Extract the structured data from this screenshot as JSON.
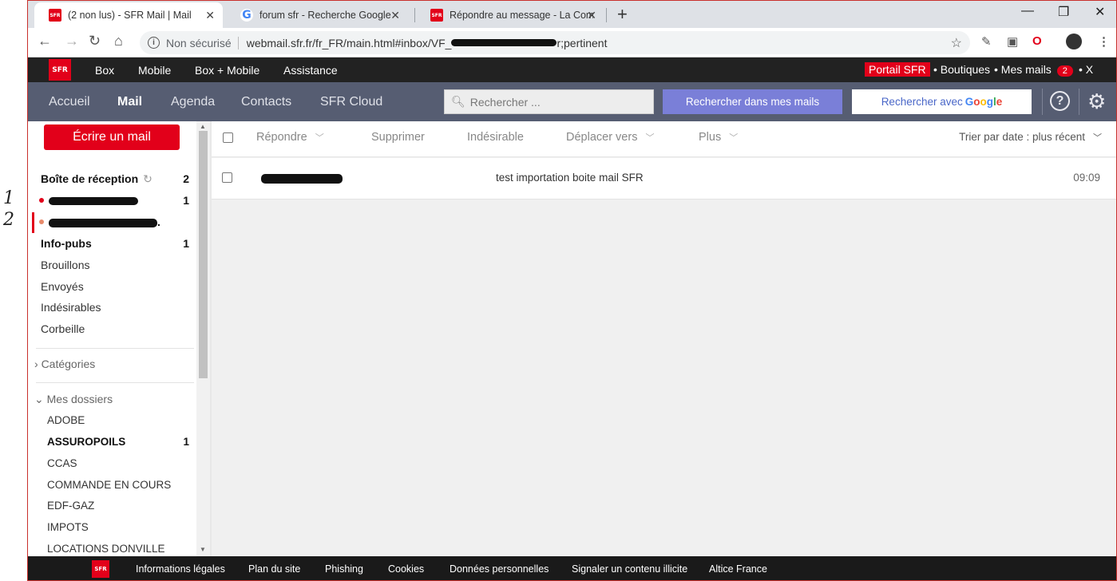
{
  "annotations": {
    "mark1": "1",
    "mark2": "2"
  },
  "browser": {
    "tabs": [
      {
        "title": "(2 non lus) - SFR Mail | Mail",
        "favicon": "sfr-logo",
        "active": true
      },
      {
        "title": "forum sfr - Recherche Google",
        "favicon": "google-logo",
        "active": false
      },
      {
        "title": "Répondre au message - La Comm",
        "favicon": "sfr-logo",
        "active": false
      }
    ],
    "favicon_text": "SFR",
    "address": {
      "security": "Non sécurisé",
      "url_start": "webmail.sfr.fr/fr_FR/main.html#inbox/VF_",
      "url_end": "r;pertinent"
    }
  },
  "sfr_top": {
    "logo": "SFR",
    "nav": [
      "Box",
      "Mobile",
      "Box + Mobile",
      "Assistance"
    ],
    "portal": "Portail SFR",
    "boutiques": "• Boutiques",
    "mes_mails": "• Mes mails",
    "mail_count": "2",
    "close": "• X"
  },
  "mail_nav": {
    "items": [
      "Accueil",
      "Mail",
      "Agenda",
      "Contacts",
      "SFR Cloud"
    ],
    "active": "Mail",
    "search_placeholder": "Rechercher ...",
    "search_button": "Rechercher dans mes mails",
    "google_button": "Rechercher avec"
  },
  "sidebar": {
    "compose": "Écrire un mail",
    "inbox": {
      "label": "Boîte de réception",
      "count": "2"
    },
    "account1_count": "1",
    "account2_suffix": ".",
    "folders": [
      {
        "label": "Info-pubs",
        "count": "1",
        "bold": true
      },
      {
        "label": "Brouillons",
        "count": "",
        "bold": false
      },
      {
        "label": "Envoyés",
        "count": "",
        "bold": false
      },
      {
        "label": "Indésirables",
        "count": "",
        "bold": false
      },
      {
        "label": "Corbeille",
        "count": "",
        "bold": false
      }
    ],
    "categories": "Catégories",
    "my_folders": "Mes dossiers",
    "subfolders": [
      {
        "label": "ADOBE",
        "count": ""
      },
      {
        "label": "ASSUROPOILS",
        "count": "1"
      },
      {
        "label": "CCAS",
        "count": ""
      },
      {
        "label": "COMMANDE EN COURS",
        "count": ""
      },
      {
        "label": "EDF-GAZ",
        "count": ""
      },
      {
        "label": "IMPOTS",
        "count": ""
      },
      {
        "label": "LOCATIONS DONVILLE",
        "count": ""
      }
    ]
  },
  "toolbar": {
    "reply": "Répondre",
    "delete": "Supprimer",
    "spam": "Indésirable",
    "move": "Déplacer vers",
    "more": "Plus",
    "sort": "Trier par date : plus récent"
  },
  "messages": [
    {
      "subject": "test importation boite mail SFR",
      "time": "09:09"
    }
  ],
  "footer": {
    "logo": "SFR",
    "links": [
      "Informations légales",
      "Plan du site",
      "Phishing",
      "Cookies",
      "Données personnelles",
      "Signaler un contenu illicite",
      "Altice France"
    ]
  },
  "colors": {
    "sfr_red": "#e2001a",
    "mail_bar": "#565d72",
    "search_button": "#7a7fd8"
  }
}
